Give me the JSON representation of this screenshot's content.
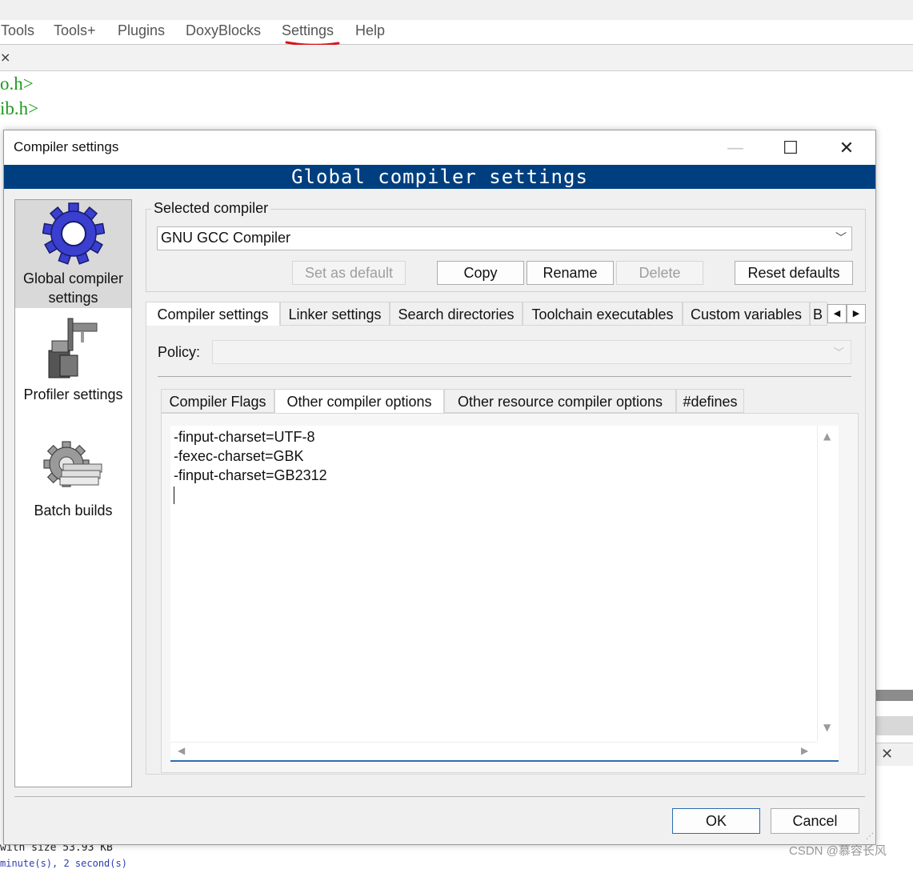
{
  "ide": {
    "menu": [
      "Tools",
      "Tools+",
      "Plugins",
      "DoxyBlocks",
      "Settings",
      "Help"
    ],
    "close_tab_glyph": "×",
    "code_lines": [
      "o.h>",
      "ib.h>"
    ],
    "log_line": "with size 53.93 KB",
    "log_line2": "minute(s), 2 second(s)",
    "watermark": "CSDN @慕容长风"
  },
  "dialog": {
    "title": "Compiler settings",
    "banner": "Global compiler settings",
    "window_buttons": {
      "minimize": "—",
      "maximize": "☐",
      "close": "✕"
    },
    "nav": [
      {
        "label_line1": "Global compiler",
        "label_line2": "settings",
        "icon": "gear-icon",
        "selected": true
      },
      {
        "label_line1": "Profiler settings",
        "label_line2": "",
        "icon": "caliper-icon",
        "selected": false
      },
      {
        "label_line1": "Batch builds",
        "label_line2": "",
        "icon": "batch-gear-icon",
        "selected": false
      }
    ],
    "selected_compiler_label": "Selected compiler",
    "selected_compiler_value": "GNU GCC Compiler",
    "buttons": {
      "set_default": "Set as default",
      "copy": "Copy",
      "rename": "Rename",
      "delete": "Delete",
      "reset_defaults": "Reset defaults"
    },
    "tabs": [
      "Compiler settings",
      "Linker settings",
      "Search directories",
      "Toolchain executables",
      "Custom variables",
      "B"
    ],
    "tab_scroll": {
      "left": "◀",
      "right": "▶"
    },
    "policy_label": "Policy:",
    "policy_value": "",
    "subtabs": [
      "Compiler Flags",
      "Other compiler options",
      "Other resource compiler options",
      "#defines"
    ],
    "active_subtab": "Other compiler options",
    "options_text": [
      "-finput-charset=UTF-8",
      "-fexec-charset=GBK",
      "-finput-charset=GB2312"
    ],
    "ok": "OK",
    "cancel": "Cancel"
  },
  "colors": {
    "banner_bg": "#003f7f",
    "annotation_red": "#d8141c",
    "code_green": "#1e9a1e"
  }
}
